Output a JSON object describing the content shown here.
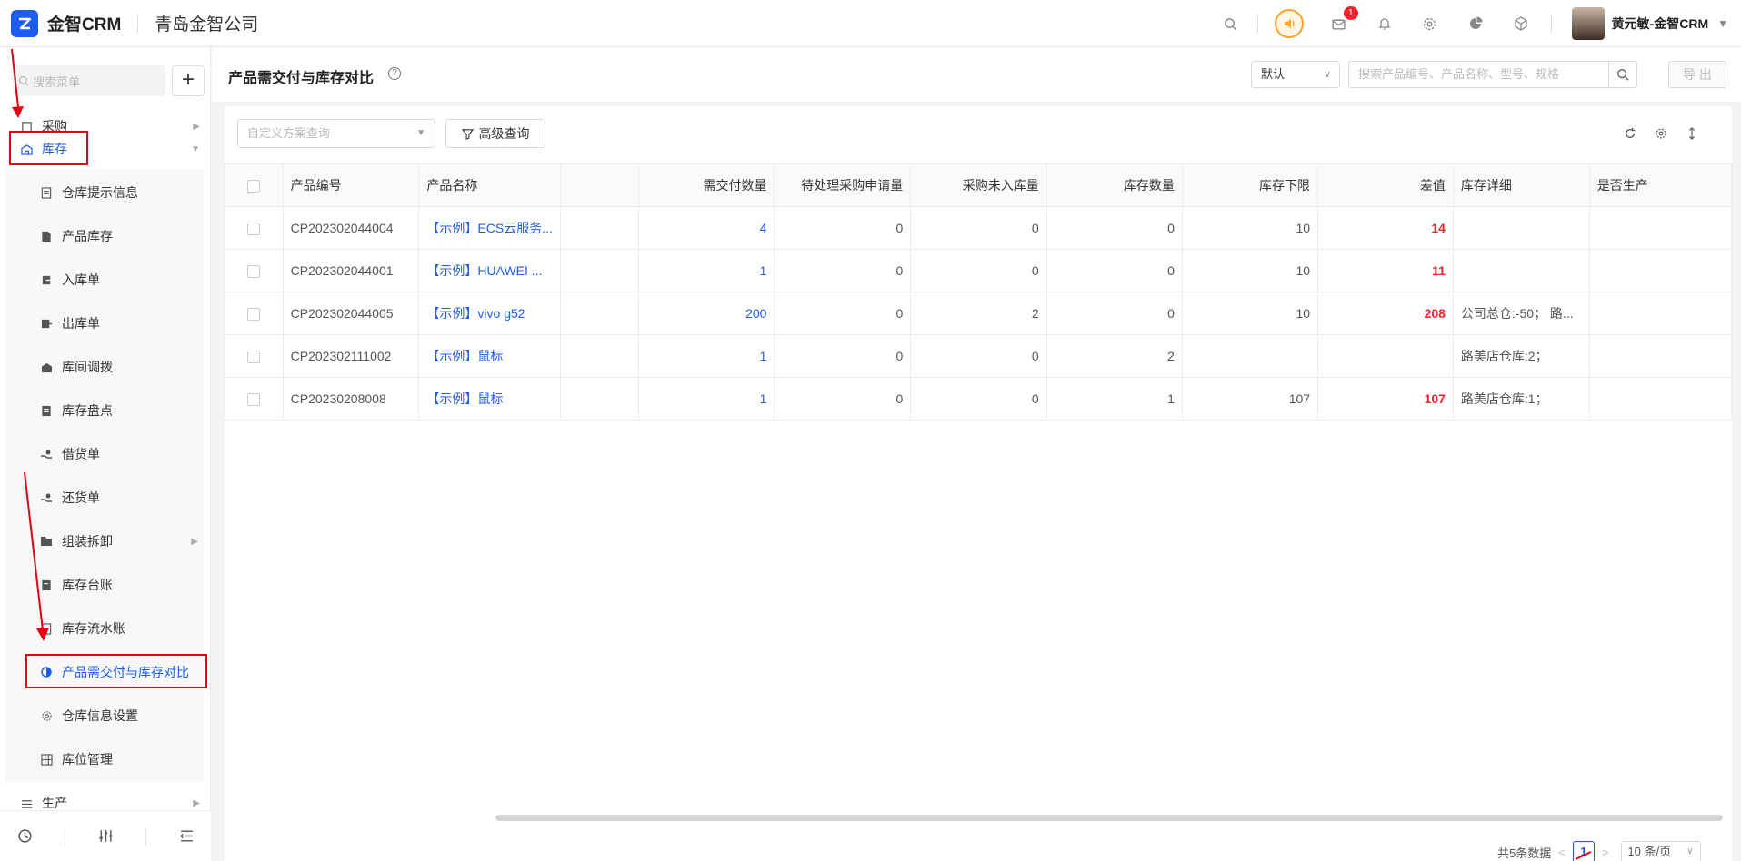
{
  "topbar": {
    "brand": "金智CRM",
    "company": "青岛金智公司",
    "notify_count": "1",
    "user_name": "黄元敏-金智CRM"
  },
  "sidebar": {
    "search_placeholder": "搜索菜单",
    "plus": "+",
    "top_items": [
      {
        "label": "采购"
      },
      {
        "label": "库存"
      }
    ],
    "sub_items": [
      {
        "label": "仓库提示信息"
      },
      {
        "label": "产品库存"
      },
      {
        "label": "入库单"
      },
      {
        "label": "出库单"
      },
      {
        "label": "库间调拨"
      },
      {
        "label": "库存盘点"
      },
      {
        "label": "借货单"
      },
      {
        "label": "还货单"
      },
      {
        "label": "组装拆卸"
      },
      {
        "label": "库存台账"
      },
      {
        "label": "库存流水账"
      },
      {
        "label": "产品需交付与库存对比"
      },
      {
        "label": "仓库信息设置"
      },
      {
        "label": "库位管理"
      }
    ],
    "bottom_item": {
      "label": "生产"
    }
  },
  "header": {
    "title": "产品需交付与库存对比",
    "help": "?",
    "select_value": "默认",
    "search_placeholder": "搜索产品编号、产品名称、型号、规格",
    "export_label": "导 出"
  },
  "toolbar": {
    "scheme_placeholder": "自定义方案查询",
    "advanced_label": "高级查询"
  },
  "table": {
    "columns": [
      "产品编号",
      "产品名称",
      "",
      "需交付数量",
      "待处理采购申请量",
      "采购未入库量",
      "库存数量",
      "库存下限",
      "差值",
      "库存详细",
      "是否生产"
    ],
    "rows": [
      [
        "CP202302044004",
        "【示例】ECS云服务...",
        "",
        "4",
        "0",
        "0",
        "0",
        "10",
        "14",
        "",
        ""
      ],
      [
        "CP202302044001",
        "【示例】HUAWEI ...",
        "",
        "1",
        "0",
        "0",
        "0",
        "10",
        "11",
        "",
        ""
      ],
      [
        "CP202302044005",
        "【示例】vivo g52",
        "",
        "200",
        "0",
        "2",
        "0",
        "10",
        "208",
        "公司总仓:-50；   路...",
        ""
      ],
      [
        "CP202302111002",
        "【示例】鼠标",
        "",
        "1",
        "0",
        "0",
        "2",
        "",
        "",
        "路美店仓库:2；",
        ""
      ],
      [
        "CP20230208008",
        "【示例】鼠标",
        "",
        "1",
        "0",
        "0",
        "1",
        "107",
        "107",
        "路美店仓库:1；",
        ""
      ]
    ]
  },
  "pager": {
    "total": "共5条数据",
    "prev": "<",
    "current": "1",
    "next": ">",
    "page_size": "10 条/页"
  },
  "colors": {
    "primary": "#1e5bf0",
    "danger": "#f5222d",
    "annotation": "#e60012"
  }
}
